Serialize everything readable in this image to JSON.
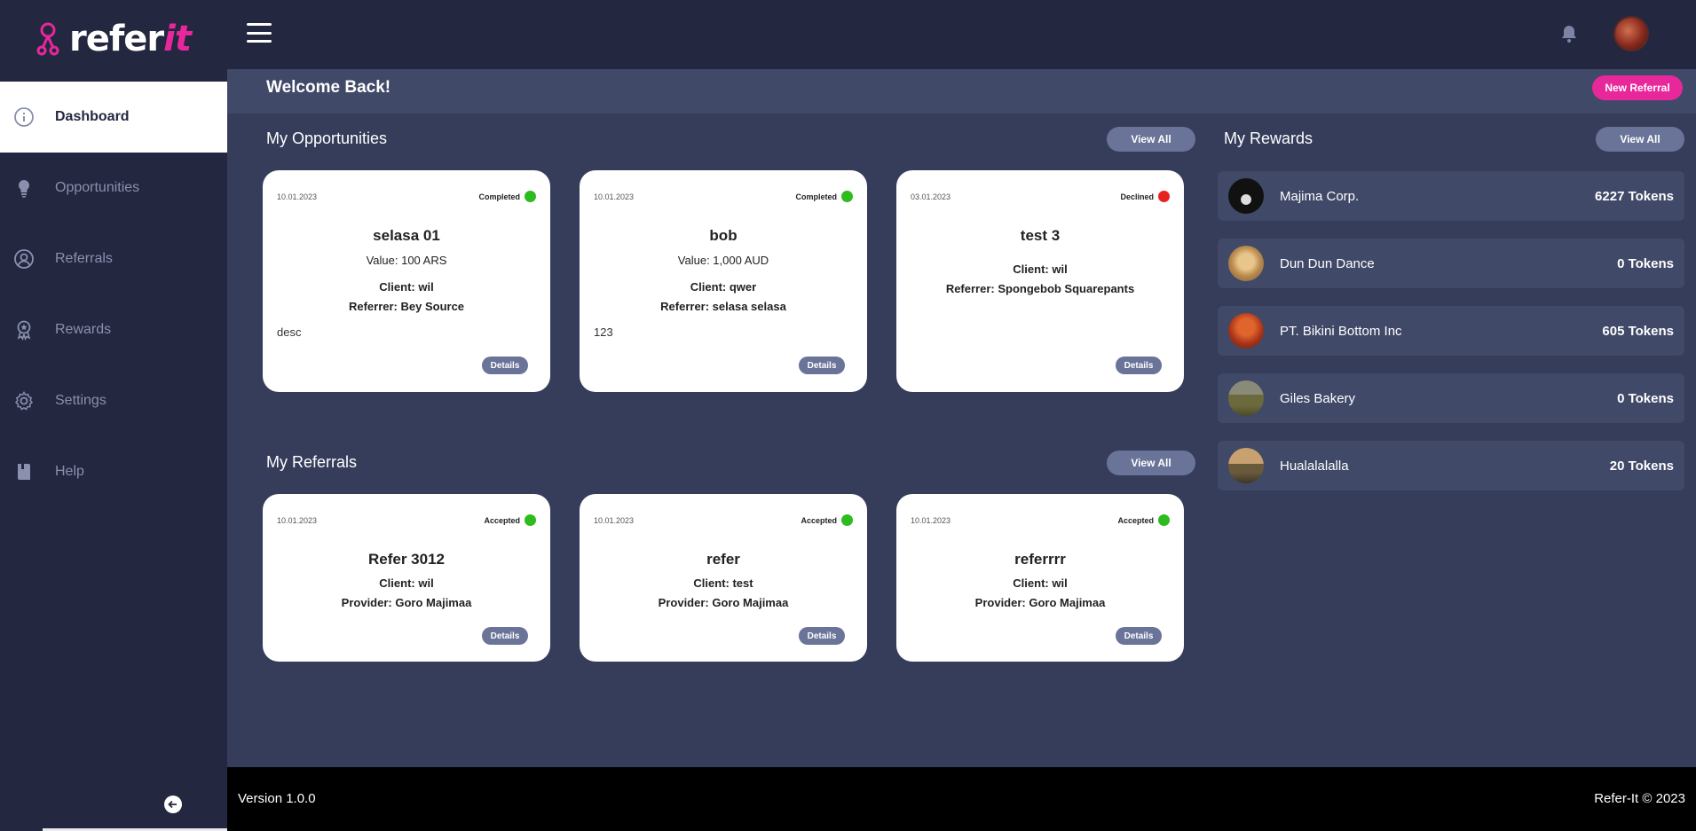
{
  "brand": {
    "name_part1": "refer",
    "name_part2": "it"
  },
  "sidebar": {
    "items": [
      {
        "label": "Dashboard",
        "icon": "info-circle-icon"
      },
      {
        "label": "Opportunities",
        "icon": "lightbulb-icon"
      },
      {
        "label": "Referrals",
        "icon": "user-circle-icon"
      },
      {
        "label": "Rewards",
        "icon": "award-icon"
      },
      {
        "label": "Settings",
        "icon": "gear-icon"
      },
      {
        "label": "Help",
        "icon": "book-icon"
      }
    ],
    "active": "Dashboard"
  },
  "header": {
    "welcome": "Welcome Back!",
    "new_referral": "New Referral"
  },
  "opportunities": {
    "title": "My Opportunities",
    "view_all": "View All",
    "cards": [
      {
        "date": "10.01.2023",
        "status": "Completed",
        "status_color": "#2dbb1e",
        "title": "selasa 01",
        "value": "Value: 100 ARS",
        "client": "Client: wil",
        "referrer": "Referrer: Bey Source",
        "desc": "desc",
        "details": "Details"
      },
      {
        "date": "10.01.2023",
        "status": "Completed",
        "status_color": "#2dbb1e",
        "title": "bob",
        "value": "Value: 1,000 AUD",
        "client": "Client: qwer",
        "referrer": "Referrer: selasa selasa",
        "desc": "123",
        "details": "Details"
      },
      {
        "date": "03.01.2023",
        "status": "Declined",
        "status_color": "#e8231f",
        "title": "test 3",
        "client": "Client: wil",
        "referrer": "Referrer: Spongebob Squarepants",
        "details": "Details"
      }
    ]
  },
  "referrals": {
    "title": "My Referrals",
    "view_all": "View All",
    "cards": [
      {
        "date": "10.01.2023",
        "status": "Accepted",
        "status_color": "#2dbb1e",
        "title": "Refer 3012",
        "client": "Client: wil",
        "provider": "Provider: Goro Majimaa",
        "details": "Details"
      },
      {
        "date": "10.01.2023",
        "status": "Accepted",
        "status_color": "#2dbb1e",
        "title": "refer",
        "client": "Client: test",
        "provider": "Provider: Goro Majimaa",
        "details": "Details"
      },
      {
        "date": "10.01.2023",
        "status": "Accepted",
        "status_color": "#2dbb1e",
        "title": "referrrr",
        "client": "Client: wil",
        "provider": "Provider: Goro Majimaa",
        "details": "Details"
      }
    ]
  },
  "rewards": {
    "title": "My Rewards",
    "view_all": "View All",
    "items": [
      {
        "name": "Majima Corp.",
        "tokens": "6227 Tokens"
      },
      {
        "name": "Dun Dun Dance",
        "tokens": "0 Tokens"
      },
      {
        "name": "PT. Bikini Bottom Inc",
        "tokens": "605 Tokens"
      },
      {
        "name": "Giles Bakery",
        "tokens": "0 Tokens"
      },
      {
        "name": "Hualalalalla",
        "tokens": "20 Tokens"
      }
    ]
  },
  "footer": {
    "version": "Version 1.0.0",
    "copyright": "Refer-It © 2023"
  },
  "colors": {
    "accent": "#e7279a",
    "sidebar_bg": "#232740",
    "content_bg": "#363d5b",
    "button_bg": "#6a7398"
  }
}
